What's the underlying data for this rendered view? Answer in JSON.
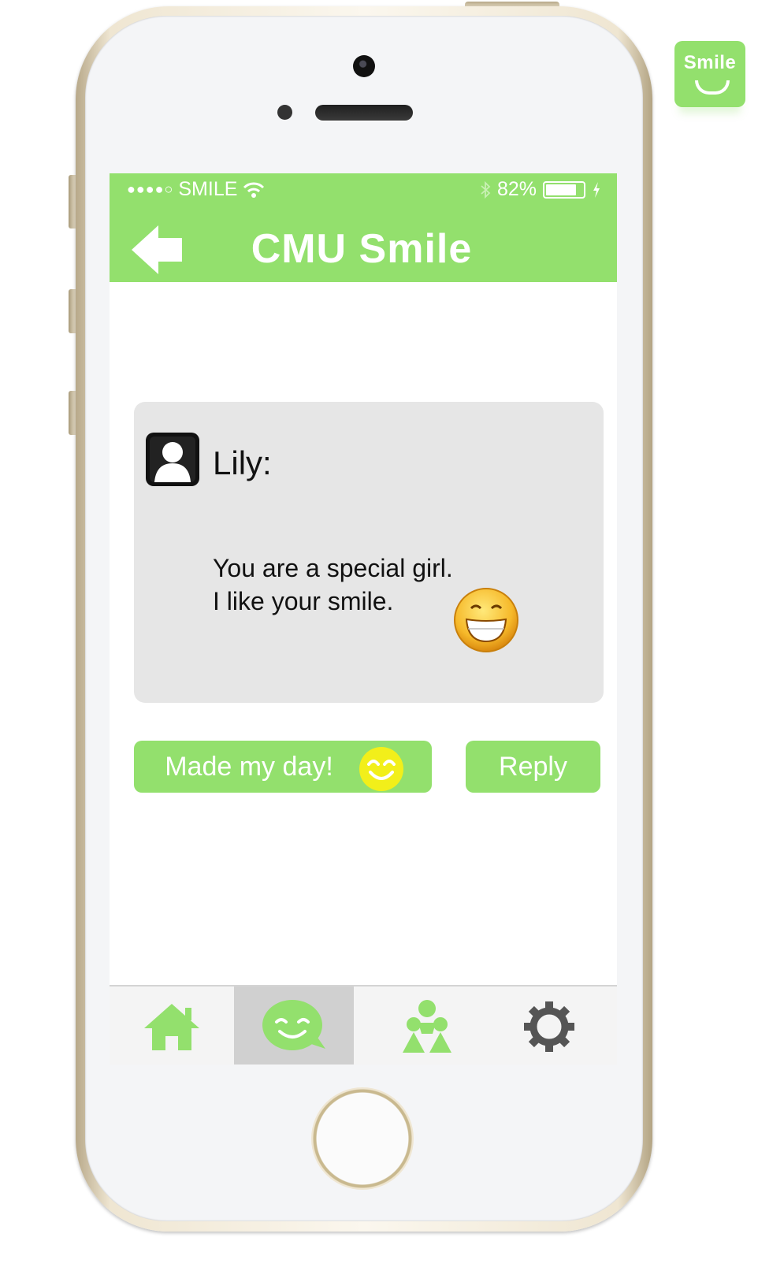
{
  "status_bar": {
    "signal_dots": "●●●●○",
    "carrier": "SMILE",
    "battery_percent": "82%",
    "battery_level": 0.82
  },
  "header": {
    "title": "CMU Smile",
    "back_icon": "back-arrow-icon"
  },
  "badge": {
    "text": "Smile"
  },
  "message": {
    "sender": "Lily:",
    "line1": "You are a special girl.",
    "line2": "I like your smile.",
    "emoji_icon": "grinning-face-icon"
  },
  "actions": {
    "made_my_day_label": "Made my day!",
    "reply_label": "Reply"
  },
  "tabbar": {
    "tabs": [
      {
        "icon": "home-icon",
        "active": false
      },
      {
        "icon": "smile-chat-icon",
        "active": true
      },
      {
        "icon": "friends-icon",
        "active": false
      },
      {
        "icon": "settings-gear-icon",
        "active": false
      }
    ]
  },
  "colors": {
    "accent": "#93e06d",
    "card_bg": "#e6e6e6",
    "tab_active_bg": "#d0d0d0"
  }
}
